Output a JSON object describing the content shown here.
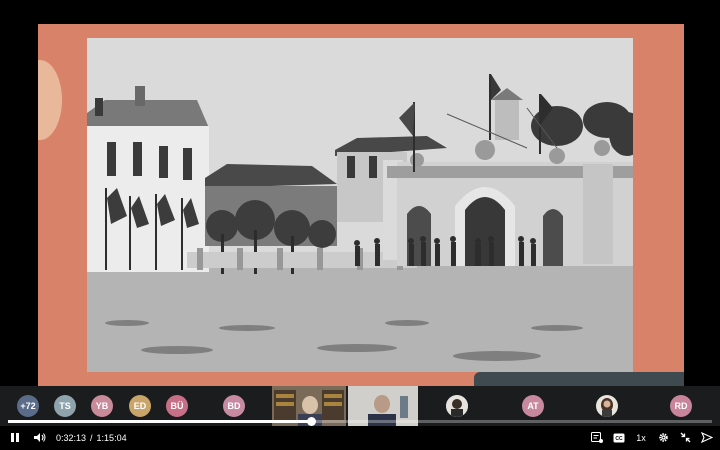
{
  "player": {
    "current_time": "0:32:13",
    "time_separator": "/",
    "duration": "1:15:04",
    "progress_fraction": 0.43,
    "speed_label": "1x"
  },
  "participants": {
    "more_count": "+72",
    "avatars": [
      {
        "initials": "TS",
        "color": "#8fa3ad"
      },
      {
        "initials": "YB",
        "color": "#c98a9a"
      },
      {
        "initials": "ED",
        "color": "#c9a56a"
      },
      {
        "initials": "BÜ",
        "color": "#c76f86"
      },
      {
        "initials": "BD",
        "color": "#c88aa0"
      },
      {
        "initials": "AT",
        "color": "#c8899f"
      },
      {
        "initials": "RD",
        "color": "#c7849a"
      }
    ]
  },
  "colors": {
    "slide_background": "#d9826a",
    "player_background": "#000000"
  }
}
